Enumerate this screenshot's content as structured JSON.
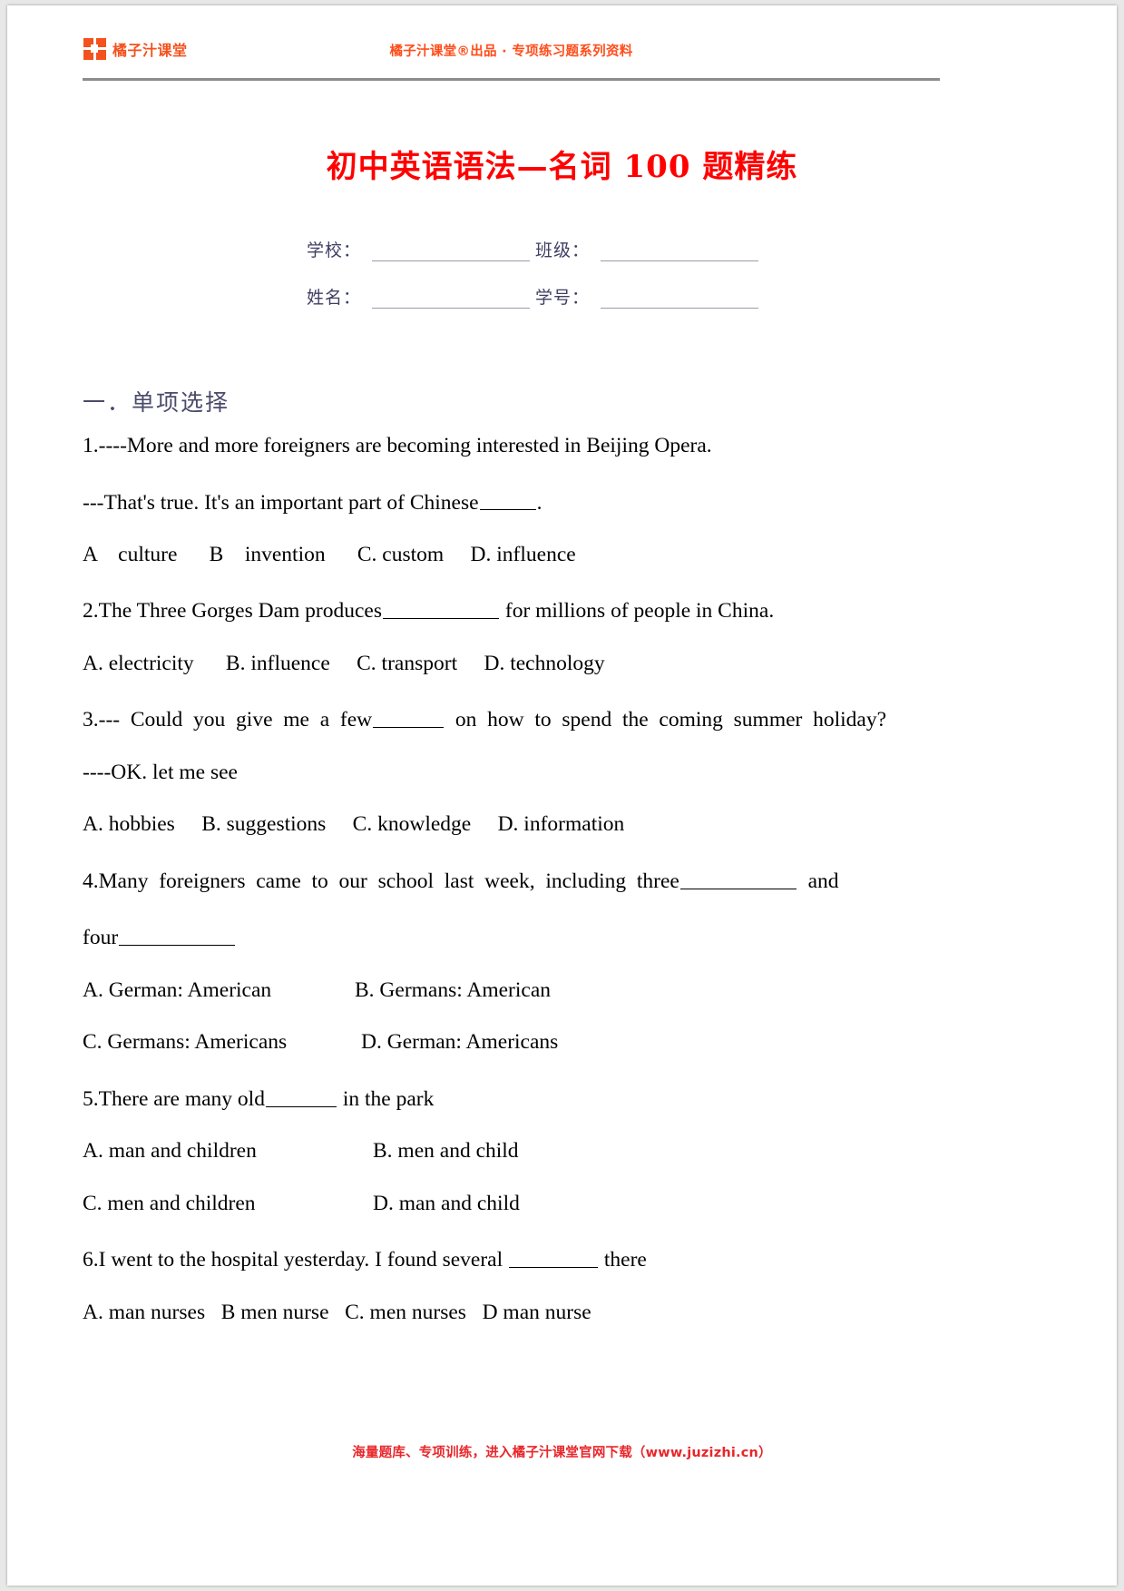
{
  "header": {
    "logo_icon": "four-square-grid-icon",
    "brand_name": "橘子汁课堂",
    "center_text": "橘子汁课堂®出品 · 专项练习题系列资料",
    "brand_color": "#f4511e",
    "rule_color": "#8c8c8c"
  },
  "title": {
    "text": "初中英语语法—名词 100 题精练",
    "color": "#ff0000"
  },
  "info_fields": [
    {
      "label": "学校：",
      "value": ""
    },
    {
      "label": "班级：",
      "value": ""
    },
    {
      "label": "姓名：",
      "value": ""
    },
    {
      "label": "学号：",
      "value": ""
    }
  ],
  "section": {
    "heading": "一．单项选择"
  },
  "questions": [
    {
      "id": "q1",
      "stem_line1": "1.----More and more foreigners are becoming interested in Beijing Opera.",
      "stem_line2_pre": "---That's true. It's an important part of Chinese",
      "stem_line2_post": ".",
      "options_line": "A    culture      B    invention      C. custom     D. influence"
    },
    {
      "id": "q2",
      "stem_pre": "2.The Three Gorges Dam produces",
      "stem_post": " for millions of people in China.",
      "options_line": "A. electricity      B. influence     C. transport     D. technology"
    },
    {
      "id": "q3",
      "stem_pre": "3.---  Could  you  give  me  a  few",
      "stem_post": "  on  how  to  spend  the  coming  summer  holiday?",
      "reply": "----OK. let me see",
      "options_line": "A. hobbies     B. suggestions     C. knowledge     D. information"
    },
    {
      "id": "q4",
      "stem_pre": "4.Many  foreigners  came  to  our  school  last  week,  including  three",
      "stem_mid": "  and",
      "stem_tail": "four",
      "option_a": "A. German: American",
      "option_b": "B. Germans: American",
      "option_c": "C. Germans: Americans",
      "option_d": "D. German: Americans"
    },
    {
      "id": "q5",
      "stem_pre": "5.There are many old",
      "stem_post": " in the park",
      "option_a": "A. man and children",
      "option_b": "B. men and child",
      "option_c": "C. men and children",
      "option_d": "D. man and child"
    },
    {
      "id": "q6",
      "stem_pre": "6.I went to the hospital yesterday. I found several ",
      "stem_post": " there",
      "options_line": "A. man nurses   B men nurse   C. men nurses   D man nurse"
    }
  ],
  "footer": {
    "text": "海量题库、专项训练，进入橘子汁课堂官网下载（www.juzizhi.cn）",
    "color": "#e8262a"
  }
}
